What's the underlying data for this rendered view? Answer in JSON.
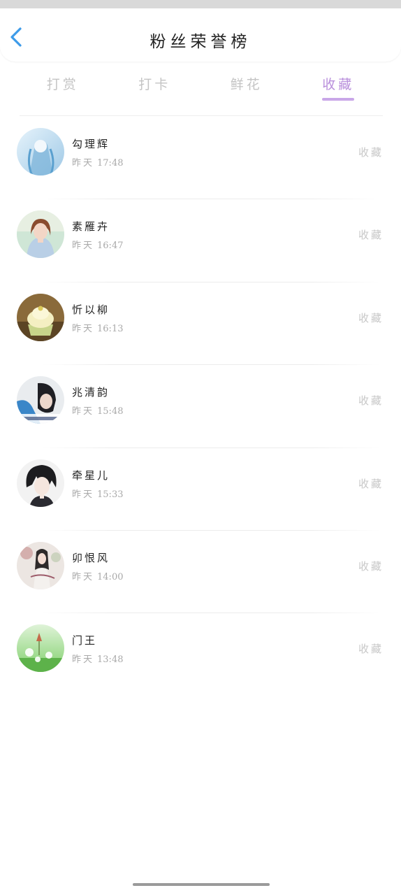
{
  "header": {
    "title": "粉丝荣誉榜",
    "back_icon": "chevron-left-icon",
    "accent_color": "#3d9be9"
  },
  "tabs": [
    {
      "label": "打赏",
      "active": false
    },
    {
      "label": "打卡",
      "active": false
    },
    {
      "label": "鲜花",
      "active": false
    },
    {
      "label": "收藏",
      "active": true
    }
  ],
  "colors": {
    "active_tab": "#b98fdc",
    "active_tab_underline": "#c9a7e8",
    "inactive_tab": "#c4c4c4",
    "secondary_text": "#a9a9a9"
  },
  "fans": [
    {
      "name": "勾理辉",
      "day": "昨天",
      "time": "17:48",
      "action": "收藏"
    },
    {
      "name": "素雁卉",
      "day": "昨天",
      "time": "16:47",
      "action": "收藏"
    },
    {
      "name": "忻以柳",
      "day": "昨天",
      "time": "16:13",
      "action": "收藏"
    },
    {
      "name": "兆清韵",
      "day": "昨天",
      "time": "15:48",
      "action": "收藏"
    },
    {
      "name": "牵星儿",
      "day": "昨天",
      "time": "15:33",
      "action": "收藏"
    },
    {
      "name": "卯恨风",
      "day": "昨天",
      "time": "14:00",
      "action": "收藏"
    },
    {
      "name": "门王",
      "day": "昨天",
      "time": "13:48",
      "action": "收藏"
    }
  ]
}
